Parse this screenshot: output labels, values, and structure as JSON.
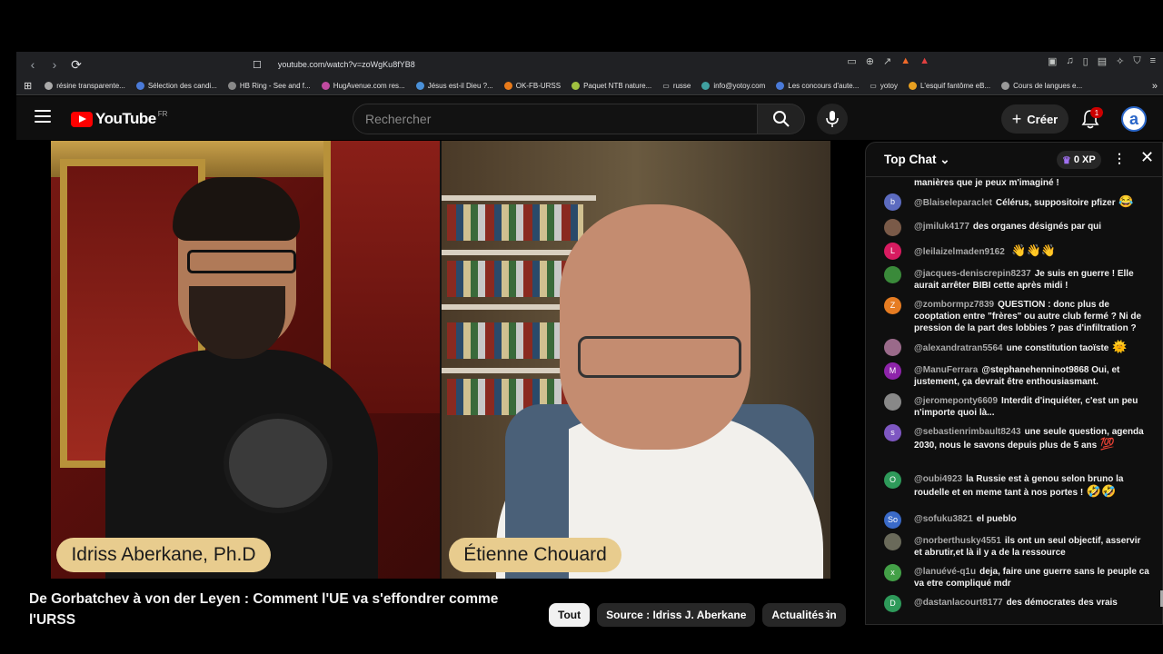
{
  "browser": {
    "url": "youtube.com/watch?v=zoWgKu8fYB8",
    "bookmarks": [
      {
        "label": "résine transparente...",
        "color": "#aaaaaa"
      },
      {
        "label": "Sélection des candi...",
        "color": "#4a7ad8"
      },
      {
        "label": "HB Ring - See and f...",
        "color": "#888888"
      },
      {
        "label": "HugAvenue.com res...",
        "color": "#c04aa0"
      },
      {
        "label": "Jésus est-il Dieu ?...",
        "color": "#4a90d8"
      },
      {
        "label": "OK-FB-URSS",
        "color": "#e87a1a"
      },
      {
        "label": "Paquet NTB nature...",
        "color": "#a0c040"
      },
      {
        "label": "russe",
        "color": "#888888"
      },
      {
        "label": "info@yotoy.com",
        "color": "#40a0a0"
      },
      {
        "label": "Les concours d'aute...",
        "color": "#4a7ad8"
      },
      {
        "label": "yotoy",
        "color": "#888888"
      },
      {
        "label": "L'esquif fantôme eB...",
        "color": "#e8a020"
      },
      {
        "label": "Cours de langues e...",
        "color": "#999999"
      }
    ]
  },
  "youtube": {
    "logo": "YouTube",
    "region": "FR",
    "search_placeholder": "Rechercher",
    "create_label": "Créer",
    "notif_count": "1",
    "avatar_letter": "a"
  },
  "video": {
    "name_left": "Idriss Aberkane, Ph.D",
    "name_right": "Étienne Chouard",
    "title": "De Gorbatchev à von der Leyen : Comment l'UE va s'effondrer comme l'URSS"
  },
  "chips": [
    "Tout",
    "Source : Idriss J. Aberkane",
    "Actualités in"
  ],
  "chat": {
    "header": "Top Chat",
    "xp": "0 XP",
    "messages": [
      {
        "avatar": "",
        "color": "#0f0f0f",
        "author": "",
        "text": "manières que je peux m'imaginé !",
        "emoji": ""
      },
      {
        "avatar": "b",
        "color": "#5c6bc0",
        "author": "@Blaiseleparaclet",
        "text": "Célérus, suppositoire pfizer",
        "emoji": "😂"
      },
      {
        "avatar": "",
        "color": "#7a5a48",
        "author": "@jmiluk4177",
        "text": "des organes désignés par qui",
        "emoji": ""
      },
      {
        "avatar": "L",
        "color": "#d81b60",
        "author": "@leilaizelmaden9162",
        "text": "",
        "emoji": "👋👋👋"
      },
      {
        "avatar": "",
        "color": "#3a8a3a",
        "author": "@jacques-deniscrepin8237",
        "text": "Je suis en guerre ! Elle aurait arrêter BIBI cette après midi !",
        "emoji": ""
      },
      {
        "avatar": "Z",
        "color": "#e67c22",
        "author": "@zombormpz7839",
        "text": "QUESTION : donc plus de cooptation entre \"frères\" ou autre club fermé ? Ni de pression de la part des lobbies ? pas d'infiltration ?",
        "emoji": ""
      },
      {
        "avatar": "",
        "color": "#9a6a8a",
        "author": "@alexandratran5564",
        "text": "une constitution taoïste",
        "emoji": "🌞"
      },
      {
        "avatar": "M",
        "color": "#8e24aa",
        "author": "@ManuFerrara",
        "text": "@stephanehenninot9868 Oui, et justement, ça devrait être enthousiasmant.",
        "emoji": ""
      },
      {
        "avatar": "",
        "color": "#888888",
        "author": "@jeromeponty6609",
        "text": "Interdit d'inquiéter, c'est un peu n'importe quoi là...",
        "emoji": ""
      },
      {
        "avatar": "s",
        "color": "#7e57c2",
        "author": "@sebastienrimbault8243",
        "text": "une seule question, agenda 2030, nous le savons depuis plus de 5 ans",
        "emoji": "💯"
      },
      {
        "avatar": "O",
        "color": "#2e9a5a",
        "author": "@oubi4923",
        "text": "la Russie est à genou selon bruno la roudelle et en meme tant à nos portes !",
        "emoji": "🤣🤣"
      },
      {
        "avatar": "So",
        "color": "#3a6ac8",
        "author": "@sofuku3821",
        "text": "el pueblo",
        "emoji": ""
      },
      {
        "avatar": "",
        "color": "#6a6a5a",
        "author": "@norberthusky4551",
        "text": "ils ont un seul objectif, asservir et abrutir,et là il y a de la ressource",
        "emoji": ""
      },
      {
        "avatar": "x",
        "color": "#43a047",
        "author": "@lanuévé-q1u",
        "text": "deja, faire une guerre sans le peuple ca va etre compliqué mdr",
        "emoji": ""
      },
      {
        "avatar": "D",
        "color": "#2e9a5a",
        "author": "@dastanlacourt8177",
        "text": "des démocrates des vrais",
        "emoji": ""
      }
    ]
  }
}
